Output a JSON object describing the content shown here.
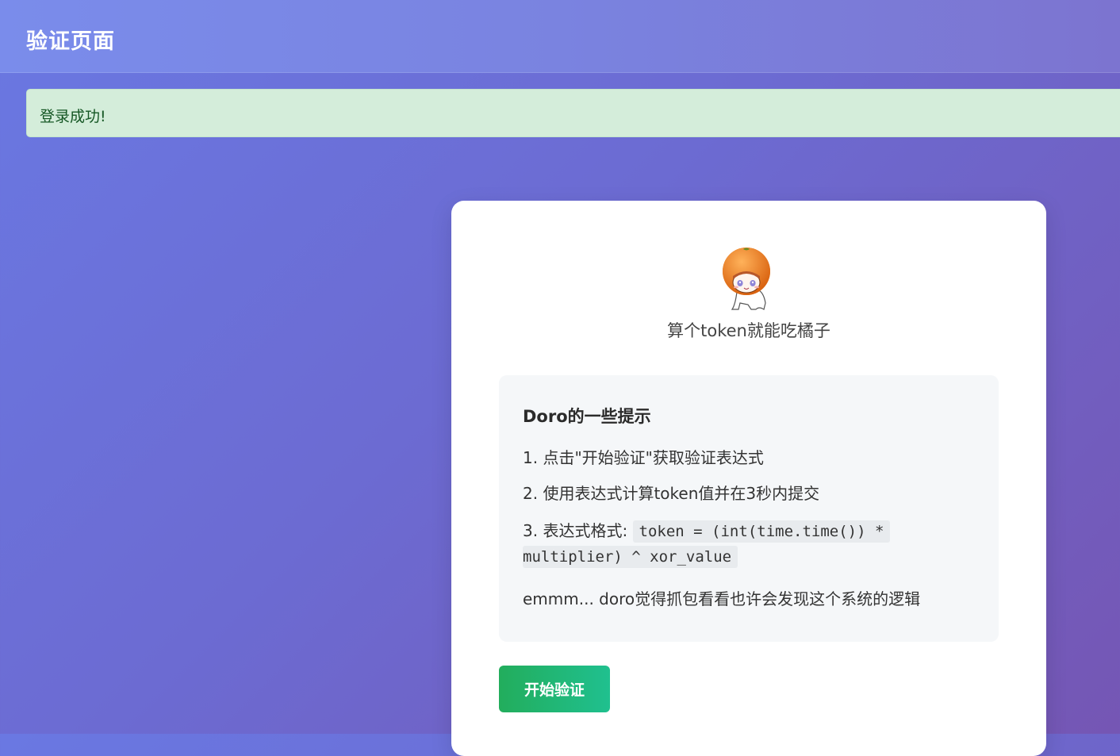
{
  "header": {
    "title": "验证页面"
  },
  "alert": {
    "message": "登录成功!"
  },
  "card": {
    "mascot_icon": "orange-head-chibi-icon",
    "subtitle": "算个token就能吃橘子",
    "hints": {
      "title": "Doro的一些提示",
      "line1": "1. 点击\"开始验证\"获取验证表达式",
      "line2": "2. 使用表达式计算token值并在3秒内提交",
      "line3_prefix": "3. 表达式格式:",
      "line3_code_part1": "token = (int(time.time()) *",
      "line3_code_part2": "multiplier) ^ xor_value",
      "line4": "emmm... doro觉得抓包看看也许会发现这个系统的逻辑"
    },
    "button_label": "开始验证"
  },
  "colors": {
    "background_start": "#6a78e2",
    "background_end": "#7556b4",
    "alert_bg": "#d4edda",
    "alert_text": "#155724",
    "button_start": "#22ad5c",
    "button_end": "#20c08f"
  }
}
